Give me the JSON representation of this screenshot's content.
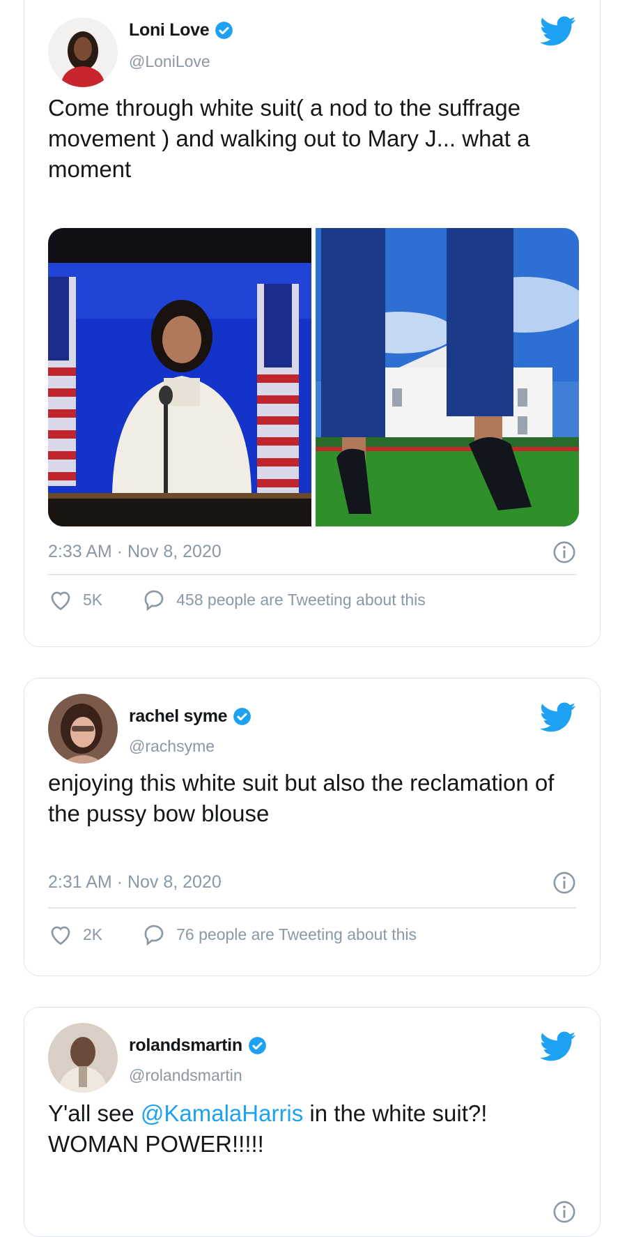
{
  "tweets": [
    {
      "name": "Loni Love",
      "handle": "@LoniLove",
      "text": "Come through white suit( a nod to the suffrage movement ) and walking out to Mary J... what a moment",
      "timestamp": "2:33 AM · Nov 8, 2020",
      "likes": "5K",
      "talking": "458 people are Tweeting about this"
    },
    {
      "name": "rachel syme",
      "handle": "@rachsyme",
      "text": "enjoying this white suit but also the reclamation of the pussy bow blouse",
      "timestamp": "2:31 AM · Nov 8, 2020",
      "likes": "2K",
      "talking": "76 people are Tweeting about this"
    },
    {
      "name": "rolandsmartin",
      "handle": "@rolandsmartin",
      "text_before": "Y'all see ",
      "mention": "@KamalaHarris",
      "text_after": " in the white suit?! WOMAN POWER!!!!!"
    }
  ],
  "colors": {
    "accent": "#1da1f2",
    "secondary_text": "#8a98a5",
    "border": "#dfe5ea"
  },
  "icons": [
    "verified-badge-icon",
    "twitter-bird-icon",
    "info-icon",
    "heart-icon",
    "comment-bubble-icon"
  ]
}
